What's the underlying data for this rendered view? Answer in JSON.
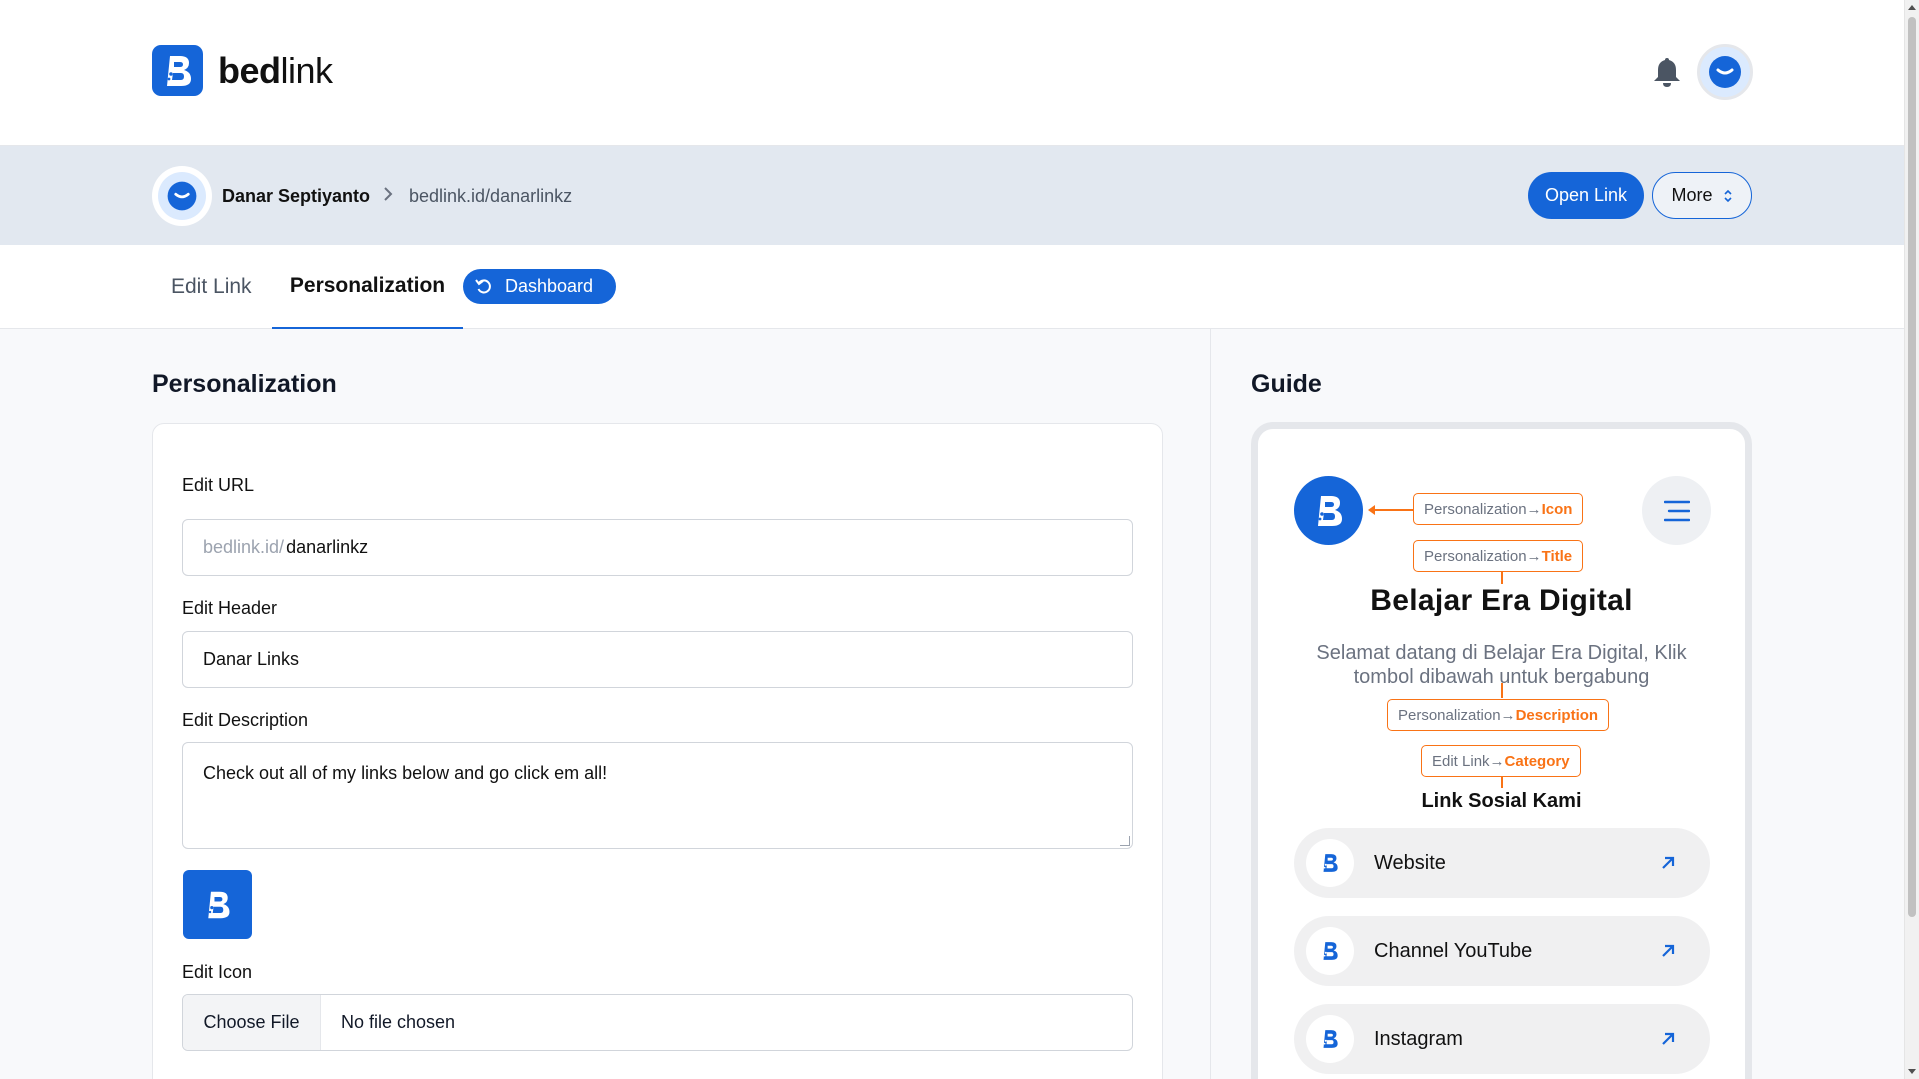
{
  "brand": {
    "name_bold": "bed",
    "name_light": "link",
    "accent": "#1565d8",
    "highlight": "#f97316"
  },
  "profile": {
    "name": "Danar Septiyanto",
    "link": "bedlink.id/danarlinkz"
  },
  "actions": {
    "open_link": "Open Link",
    "more": "More"
  },
  "tabs": {
    "edit_link": "Edit Link",
    "personalization": "Personalization",
    "dashboard": "Dashboard"
  },
  "form": {
    "title": "Personalization",
    "url_label": "Edit URL",
    "url_prefix": "bedlink.id/",
    "url_value": "danarlinkz",
    "header_label": "Edit Header",
    "header_value": "Danar Links",
    "description_label": "Edit Description",
    "description_value": "Check out all of my links below and go click em all!",
    "icon_label": "Edit Icon",
    "choose_file": "Choose File",
    "no_file": "No file chosen"
  },
  "guide": {
    "title": "Guide",
    "tag_icon": {
      "prefix": "Personalization→",
      "key": "Icon"
    },
    "tag_title": {
      "prefix": "Personalization→",
      "key": "Title"
    },
    "tag_description": {
      "prefix": "Personalization→",
      "key": "Description"
    },
    "tag_category": {
      "prefix": "Edit Link→",
      "key": "Category"
    },
    "page_title": "Belajar Era Digital",
    "page_description": "Selamat datang di Belajar Era Digital, Klik tombol dibawah untuk bergabung",
    "category": "Link Sosial Kami",
    "links": [
      {
        "label": "Website"
      },
      {
        "label": "Channel YouTube"
      },
      {
        "label": "Instagram"
      }
    ]
  }
}
